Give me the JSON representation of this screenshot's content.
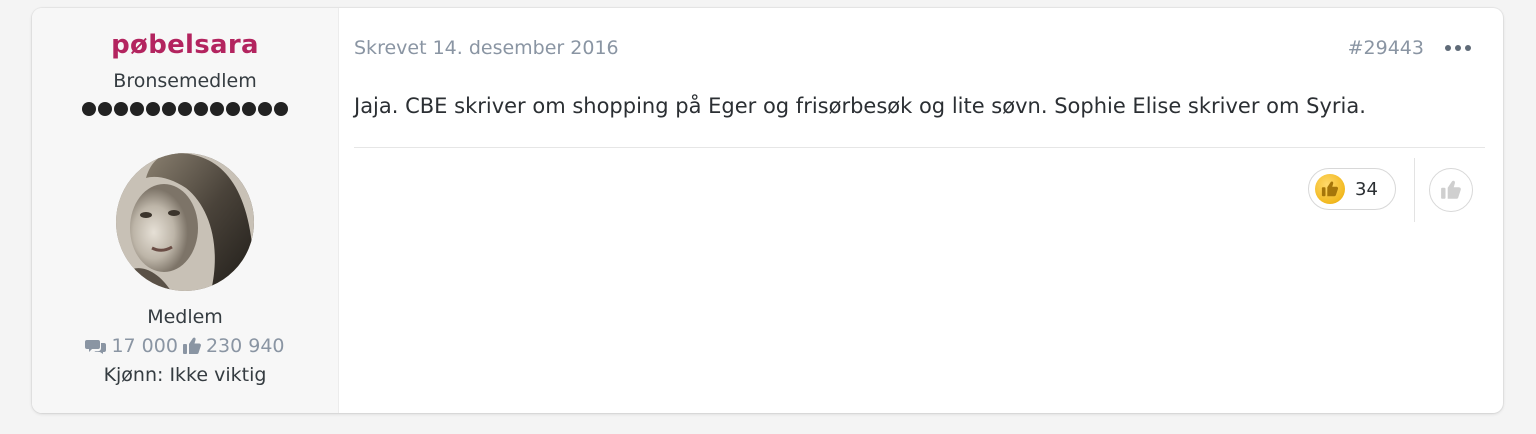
{
  "author": {
    "name": "pøbelsara",
    "rank": "Bronsemedlem",
    "rank_pips": 13,
    "group": "Medlem",
    "posts": "17 000",
    "reputation": "230 940",
    "gender_line": "Kjønn: Ikke viktig",
    "colors": {
      "name": "#b3245f"
    }
  },
  "post": {
    "date": "Skrevet 14. desember 2016",
    "number": "#29443",
    "body": "Jaja. CBE skriver om shopping på Eger og frisørbesøk og lite søvn. Sophie Elise skriver om Syria."
  },
  "reactions": {
    "like_count": "34",
    "like_icon": "thumbs-up-icon"
  }
}
